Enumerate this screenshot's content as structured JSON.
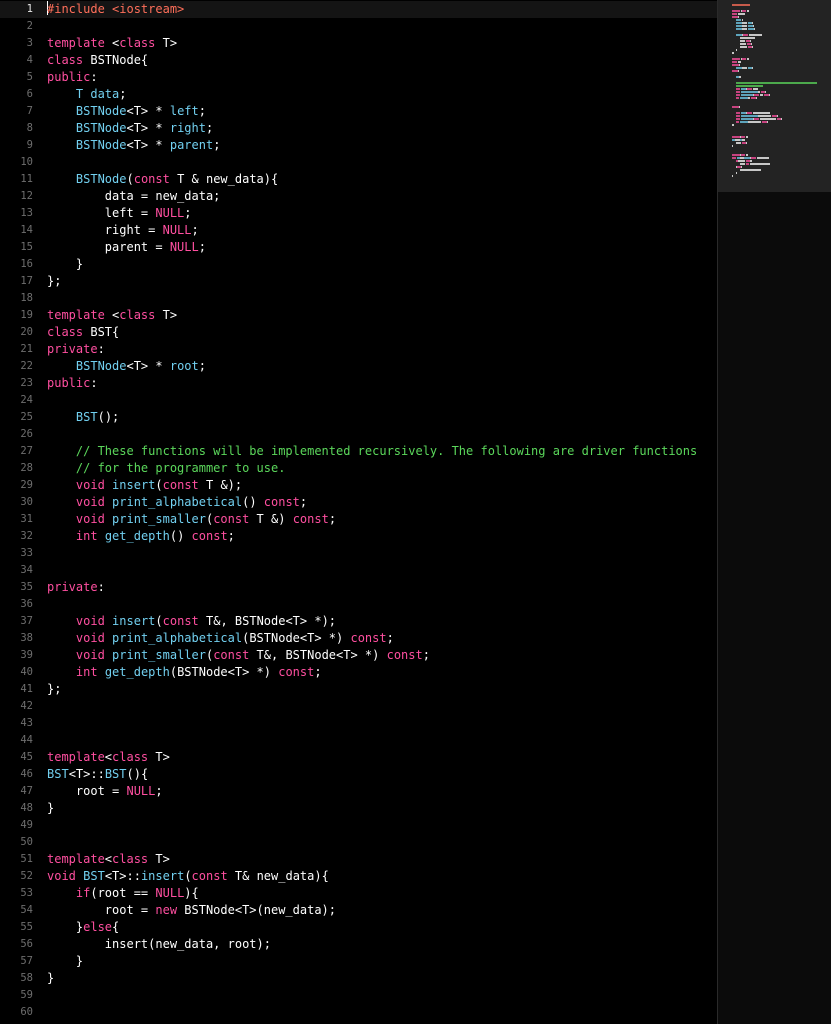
{
  "colors": {
    "plain": "#ffffff",
    "keyword": "#ff4fa0",
    "type": "#72d0f0",
    "comment": "#5bd75b",
    "preproc": "#ff6f5a",
    "gutter": "#6e6e6e",
    "background": "#000000"
  },
  "editor": {
    "current_line": 1,
    "lines": [
      {
        "n": "1",
        "tokens": [
          [
            "cursor",
            ""
          ],
          [
            "preproc",
            "#include <iostream>"
          ]
        ]
      },
      {
        "n": "2",
        "tokens": []
      },
      {
        "n": "3",
        "tokens": [
          [
            "keyword",
            "template"
          ],
          [
            "plain",
            " <"
          ],
          [
            "keyword",
            "class"
          ],
          [
            "plain",
            " T>"
          ]
        ]
      },
      {
        "n": "4",
        "tokens": [
          [
            "keyword",
            "class"
          ],
          [
            "plain",
            " BSTNode{"
          ]
        ]
      },
      {
        "n": "5",
        "tokens": [
          [
            "keyword",
            "public"
          ],
          [
            "plain",
            ":"
          ]
        ]
      },
      {
        "n": "6",
        "tokens": [
          [
            "plain",
            "    "
          ],
          [
            "type",
            "T data"
          ],
          [
            "plain",
            ";"
          ]
        ]
      },
      {
        "n": "7",
        "tokens": [
          [
            "plain",
            "    "
          ],
          [
            "type",
            "BSTNode"
          ],
          [
            "plain",
            "<T> * "
          ],
          [
            "type",
            "left"
          ],
          [
            "plain",
            ";"
          ]
        ]
      },
      {
        "n": "8",
        "tokens": [
          [
            "plain",
            "    "
          ],
          [
            "type",
            "BSTNode"
          ],
          [
            "plain",
            "<T> * "
          ],
          [
            "type",
            "right"
          ],
          [
            "plain",
            ";"
          ]
        ]
      },
      {
        "n": "9",
        "tokens": [
          [
            "plain",
            "    "
          ],
          [
            "type",
            "BSTNode"
          ],
          [
            "plain",
            "<T> * "
          ],
          [
            "type",
            "parent"
          ],
          [
            "plain",
            ";"
          ]
        ]
      },
      {
        "n": "10",
        "tokens": []
      },
      {
        "n": "11",
        "tokens": [
          [
            "plain",
            "    "
          ],
          [
            "type",
            "BSTNode"
          ],
          [
            "plain",
            "("
          ],
          [
            "keyword",
            "const"
          ],
          [
            "plain",
            " T & new_data){"
          ]
        ]
      },
      {
        "n": "12",
        "tokens": [
          [
            "plain",
            "        data = new_data;"
          ]
        ]
      },
      {
        "n": "13",
        "tokens": [
          [
            "plain",
            "        left = "
          ],
          [
            "keyword",
            "NULL"
          ],
          [
            "plain",
            ";"
          ]
        ]
      },
      {
        "n": "14",
        "tokens": [
          [
            "plain",
            "        right = "
          ],
          [
            "keyword",
            "NULL"
          ],
          [
            "plain",
            ";"
          ]
        ]
      },
      {
        "n": "15",
        "tokens": [
          [
            "plain",
            "        parent = "
          ],
          [
            "keyword",
            "NULL"
          ],
          [
            "plain",
            ";"
          ]
        ]
      },
      {
        "n": "16",
        "tokens": [
          [
            "plain",
            "    }"
          ]
        ]
      },
      {
        "n": "17",
        "tokens": [
          [
            "plain",
            "};"
          ]
        ]
      },
      {
        "n": "18",
        "tokens": []
      },
      {
        "n": "19",
        "tokens": [
          [
            "keyword",
            "template"
          ],
          [
            "plain",
            " <"
          ],
          [
            "keyword",
            "class"
          ],
          [
            "plain",
            " T>"
          ]
        ]
      },
      {
        "n": "20",
        "tokens": [
          [
            "keyword",
            "class"
          ],
          [
            "plain",
            " BST{"
          ]
        ]
      },
      {
        "n": "21",
        "tokens": [
          [
            "keyword",
            "private"
          ],
          [
            "plain",
            ":"
          ]
        ]
      },
      {
        "n": "22",
        "tokens": [
          [
            "plain",
            "    "
          ],
          [
            "type",
            "BSTNode"
          ],
          [
            "plain",
            "<T> * "
          ],
          [
            "type",
            "root"
          ],
          [
            "plain",
            ";"
          ]
        ]
      },
      {
        "n": "23",
        "tokens": [
          [
            "keyword",
            "public"
          ],
          [
            "plain",
            ":"
          ]
        ]
      },
      {
        "n": "24",
        "tokens": []
      },
      {
        "n": "25",
        "tokens": [
          [
            "plain",
            "    "
          ],
          [
            "type",
            "BST"
          ],
          [
            "plain",
            "();"
          ]
        ]
      },
      {
        "n": "26",
        "tokens": []
      },
      {
        "n": "27",
        "tokens": [
          [
            "plain",
            "    "
          ],
          [
            "comment",
            "// These functions will be implemented recursively. The following are driver functions"
          ]
        ]
      },
      {
        "n": "28",
        "tokens": [
          [
            "plain",
            "    "
          ],
          [
            "comment",
            "// for the programmer to use."
          ]
        ]
      },
      {
        "n": "29",
        "tokens": [
          [
            "plain",
            "    "
          ],
          [
            "keyword",
            "void"
          ],
          [
            "plain",
            " "
          ],
          [
            "type",
            "insert"
          ],
          [
            "plain",
            "("
          ],
          [
            "keyword",
            "const"
          ],
          [
            "plain",
            " T &);"
          ]
        ]
      },
      {
        "n": "30",
        "tokens": [
          [
            "plain",
            "    "
          ],
          [
            "keyword",
            "void"
          ],
          [
            "plain",
            " "
          ],
          [
            "type",
            "print_alphabetical"
          ],
          [
            "plain",
            "() "
          ],
          [
            "keyword",
            "const"
          ],
          [
            "plain",
            ";"
          ]
        ]
      },
      {
        "n": "31",
        "tokens": [
          [
            "plain",
            "    "
          ],
          [
            "keyword",
            "void"
          ],
          [
            "plain",
            " "
          ],
          [
            "type",
            "print_smaller"
          ],
          [
            "plain",
            "("
          ],
          [
            "keyword",
            "const"
          ],
          [
            "plain",
            " T &) "
          ],
          [
            "keyword",
            "const"
          ],
          [
            "plain",
            ";"
          ]
        ]
      },
      {
        "n": "32",
        "tokens": [
          [
            "plain",
            "    "
          ],
          [
            "keyword",
            "int"
          ],
          [
            "plain",
            " "
          ],
          [
            "type",
            "get_depth"
          ],
          [
            "plain",
            "() "
          ],
          [
            "keyword",
            "const"
          ],
          [
            "plain",
            ";"
          ]
        ]
      },
      {
        "n": "33",
        "tokens": []
      },
      {
        "n": "34",
        "tokens": []
      },
      {
        "n": "35",
        "tokens": [
          [
            "keyword",
            "private"
          ],
          [
            "plain",
            ":"
          ]
        ]
      },
      {
        "n": "36",
        "tokens": []
      },
      {
        "n": "37",
        "tokens": [
          [
            "plain",
            "    "
          ],
          [
            "keyword",
            "void"
          ],
          [
            "plain",
            " "
          ],
          [
            "type",
            "insert"
          ],
          [
            "plain",
            "("
          ],
          [
            "keyword",
            "const"
          ],
          [
            "plain",
            " T&, BSTNode<T> *);"
          ]
        ]
      },
      {
        "n": "38",
        "tokens": [
          [
            "plain",
            "    "
          ],
          [
            "keyword",
            "void"
          ],
          [
            "plain",
            " "
          ],
          [
            "type",
            "print_alphabetical"
          ],
          [
            "plain",
            "(BSTNode<T> *) "
          ],
          [
            "keyword",
            "const"
          ],
          [
            "plain",
            ";"
          ]
        ]
      },
      {
        "n": "39",
        "tokens": [
          [
            "plain",
            "    "
          ],
          [
            "keyword",
            "void"
          ],
          [
            "plain",
            " "
          ],
          [
            "type",
            "print_smaller"
          ],
          [
            "plain",
            "("
          ],
          [
            "keyword",
            "const"
          ],
          [
            "plain",
            " T&, BSTNode<T> *) "
          ],
          [
            "keyword",
            "const"
          ],
          [
            "plain",
            ";"
          ]
        ]
      },
      {
        "n": "40",
        "tokens": [
          [
            "plain",
            "    "
          ],
          [
            "keyword",
            "int"
          ],
          [
            "plain",
            " "
          ],
          [
            "type",
            "get_depth"
          ],
          [
            "plain",
            "(BSTNode<T> *) "
          ],
          [
            "keyword",
            "const"
          ],
          [
            "plain",
            ";"
          ]
        ]
      },
      {
        "n": "41",
        "tokens": [
          [
            "plain",
            "};"
          ]
        ]
      },
      {
        "n": "42",
        "tokens": []
      },
      {
        "n": "43",
        "tokens": []
      },
      {
        "n": "44",
        "tokens": []
      },
      {
        "n": "45",
        "tokens": [
          [
            "keyword",
            "template"
          ],
          [
            "plain",
            "<"
          ],
          [
            "keyword",
            "class"
          ],
          [
            "plain",
            " T>"
          ]
        ]
      },
      {
        "n": "46",
        "tokens": [
          [
            "type",
            "BST"
          ],
          [
            "plain",
            "<T>::"
          ],
          [
            "type",
            "BST"
          ],
          [
            "plain",
            "(){"
          ]
        ]
      },
      {
        "n": "47",
        "tokens": [
          [
            "plain",
            "    root = "
          ],
          [
            "keyword",
            "NULL"
          ],
          [
            "plain",
            ";"
          ]
        ]
      },
      {
        "n": "48",
        "tokens": [
          [
            "plain",
            "}"
          ]
        ]
      },
      {
        "n": "49",
        "tokens": []
      },
      {
        "n": "50",
        "tokens": []
      },
      {
        "n": "51",
        "tokens": [
          [
            "keyword",
            "template"
          ],
          [
            "plain",
            "<"
          ],
          [
            "keyword",
            "class"
          ],
          [
            "plain",
            " T>"
          ]
        ]
      },
      {
        "n": "52",
        "tokens": [
          [
            "keyword",
            "void"
          ],
          [
            "plain",
            " "
          ],
          [
            "type",
            "BST"
          ],
          [
            "plain",
            "<T>::"
          ],
          [
            "type",
            "insert"
          ],
          [
            "plain",
            "("
          ],
          [
            "keyword",
            "const"
          ],
          [
            "plain",
            " T& new_data){"
          ]
        ]
      },
      {
        "n": "53",
        "tokens": [
          [
            "plain",
            "    "
          ],
          [
            "keyword",
            "if"
          ],
          [
            "plain",
            "(root == "
          ],
          [
            "keyword",
            "NULL"
          ],
          [
            "plain",
            "){"
          ]
        ]
      },
      {
        "n": "54",
        "tokens": [
          [
            "plain",
            "        root = "
          ],
          [
            "keyword",
            "new"
          ],
          [
            "plain",
            " BSTNode<T>(new_data);"
          ]
        ]
      },
      {
        "n": "55",
        "tokens": [
          [
            "plain",
            "    }"
          ],
          [
            "keyword",
            "else"
          ],
          [
            "plain",
            "{"
          ]
        ]
      },
      {
        "n": "56",
        "tokens": [
          [
            "plain",
            "        insert(new_data, root);"
          ]
        ]
      },
      {
        "n": "57",
        "tokens": [
          [
            "plain",
            "    }"
          ]
        ]
      },
      {
        "n": "58",
        "tokens": [
          [
            "plain",
            "}"
          ]
        ]
      },
      {
        "n": "59",
        "tokens": []
      },
      {
        "n": "60",
        "tokens": []
      }
    ]
  }
}
